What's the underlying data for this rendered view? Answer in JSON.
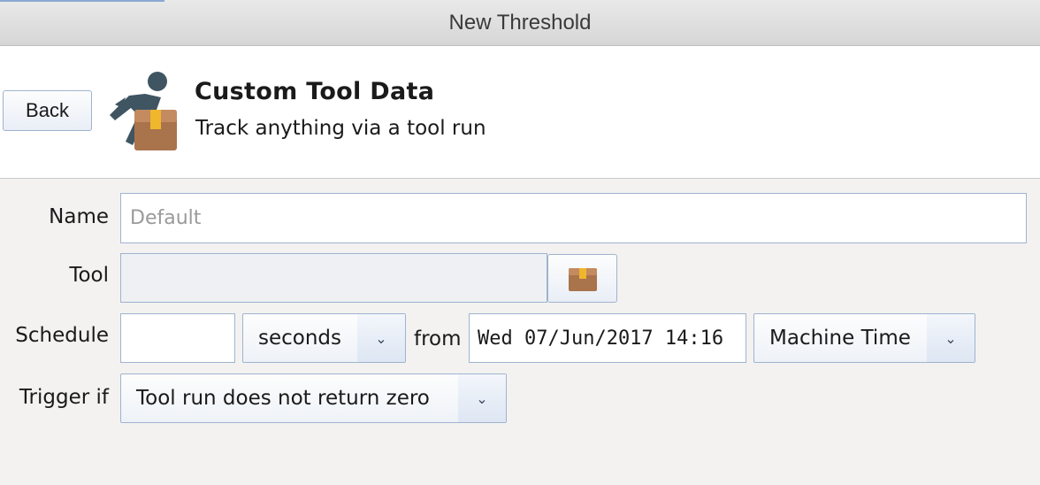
{
  "window": {
    "title": "New Threshold"
  },
  "header": {
    "back_label": "Back",
    "title": "Custom Tool Data",
    "subtitle": "Track anything via a tool run"
  },
  "form": {
    "name": {
      "label": "Name",
      "placeholder": "Default",
      "value": ""
    },
    "tool": {
      "label": "Tool",
      "value": ""
    },
    "schedule": {
      "label": "Schedule",
      "interval_value": "",
      "unit_selected": "seconds",
      "from_label": "from",
      "start_datetime": "Wed 07/Jun/2017 14:16",
      "timezone_selected": "Machine Time"
    },
    "trigger": {
      "label": "Trigger if",
      "selected": "Tool run does not return zero"
    }
  },
  "icons": {
    "hero": "runner-with-package-icon",
    "browse": "package-icon",
    "dropdown": "chevron-down-icon"
  },
  "colors": {
    "border_blue": "#9fb3cf",
    "runner": "#3f5562",
    "package": "#a9734c",
    "tape": "#f0b62c"
  }
}
